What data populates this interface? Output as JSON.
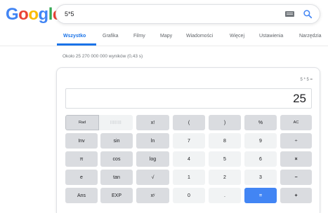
{
  "logo": {
    "letters": [
      "G",
      "o",
      "o",
      "g",
      "l",
      "e"
    ],
    "colors": [
      "#4285f4",
      "#ea4335",
      "#fbbc05",
      "#4285f4",
      "#34a853",
      "#ea4335"
    ]
  },
  "search": {
    "query": "5*5",
    "keyboard_icon": "keyboard-icon",
    "search_icon": "search-icon"
  },
  "tabs": [
    {
      "label": "Wszystko",
      "active": true
    },
    {
      "label": "Grafika"
    },
    {
      "label": "Filmy"
    },
    {
      "label": "Mapy"
    },
    {
      "label": "Wiadomości"
    },
    {
      "label": "Więcej"
    },
    {
      "label": "Ustawienia"
    },
    {
      "label": "Narzędzia"
    }
  ],
  "result_stats": "Około 25 270 000 000 wyników (0,43 s)",
  "calculator": {
    "history": "5 * 5 =",
    "result": "25",
    "mode": {
      "rad": "Rad",
      "deg": "|||||||||"
    },
    "keys": {
      "fact": "x!",
      "lparen": "(",
      "rparen": ")",
      "percent": "%",
      "ac": "AC",
      "inv": "Inv",
      "sin": "sin",
      "ln": "ln",
      "seven": "7",
      "eight": "8",
      "nine": "9",
      "divide": "÷",
      "pi": "π",
      "cos": "cos",
      "log": "log",
      "four": "4",
      "five": "5",
      "six": "6",
      "multiply": "×",
      "e": "e",
      "tan": "tan",
      "sqrt": "√",
      "one": "1",
      "two": "2",
      "three": "3",
      "minus": "−",
      "ans": "Ans",
      "exp": "EXP",
      "power": "xʸ",
      "zero": "0",
      "dot": ".",
      "equals": "=",
      "plus": "+"
    }
  }
}
